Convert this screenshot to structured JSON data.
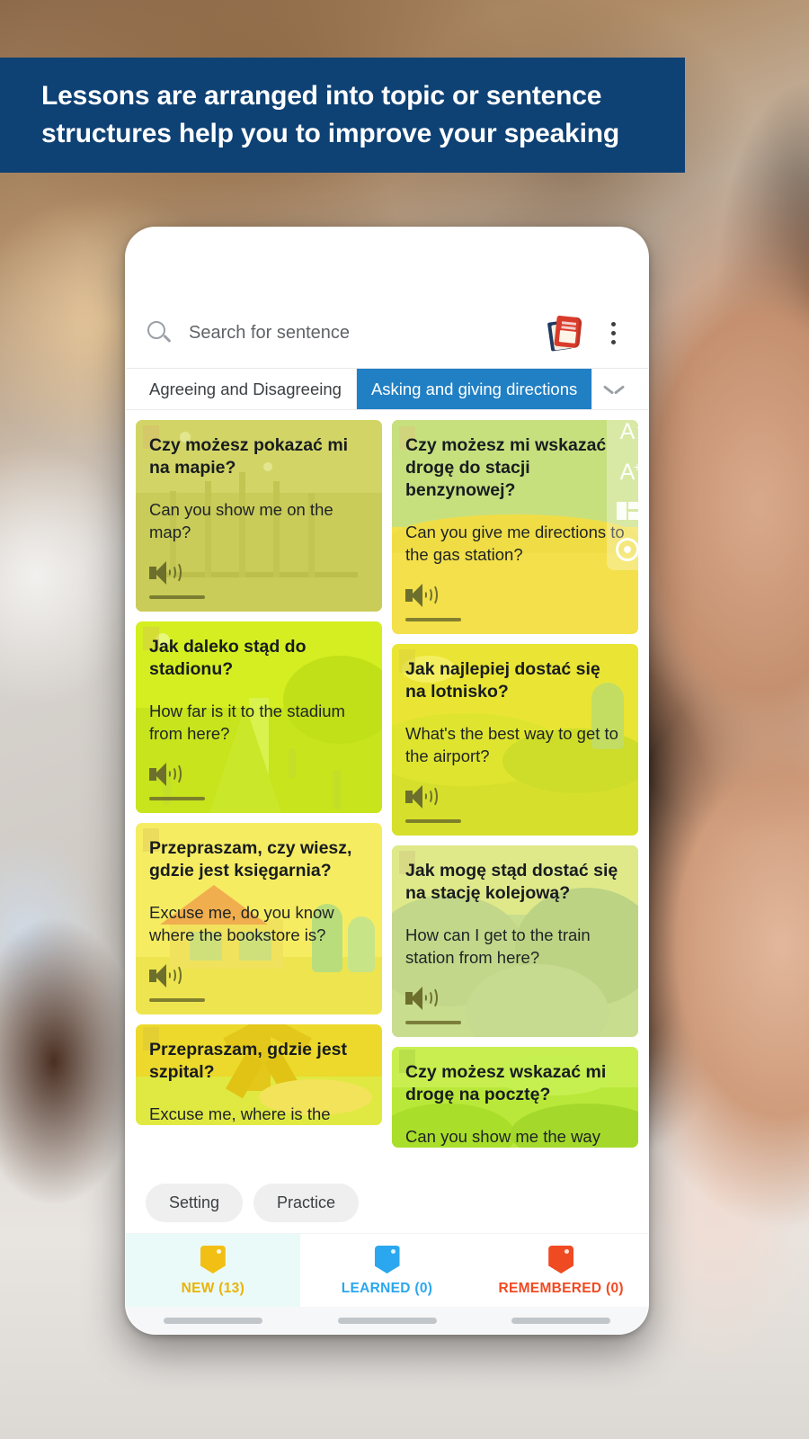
{
  "headline": {
    "line1": "Lessons are arranged into topic or sentence",
    "line2": "structures help you to improve your speaking",
    "bg_color": "#0e4174",
    "text_color": "#ffffff"
  },
  "search": {
    "placeholder": "Search for sentence",
    "icon": "search-icon",
    "book_icon": "books-icon",
    "overflow_icon": "kebab-menu-icon"
  },
  "topic_tabs": {
    "items": [
      {
        "label": "Agreeing and Disagreeing",
        "active": false
      },
      {
        "label": "Asking and giving directions",
        "active": true
      }
    ],
    "expand_icon": "chevron-down-icon",
    "active_color": "#2180c4"
  },
  "side_tools": {
    "items": [
      {
        "name": "font-decrease-icon",
        "glyph": "A",
        "sup": "-"
      },
      {
        "name": "font-increase-icon",
        "glyph": "A",
        "sup": "+"
      },
      {
        "name": "layout-grid-icon",
        "glyph": ""
      },
      {
        "name": "eye-visibility-icon",
        "glyph": ""
      }
    ]
  },
  "cards": {
    "left": [
      {
        "pl": "Czy możesz pokazać mi na mapie?",
        "en": "Can you show me on the map?",
        "theme": "bridge",
        "bg": "#d2d566",
        "audio_icon": "speaker-icon"
      },
      {
        "pl": "Jak daleko stąd do stadionu?",
        "en": "How far is it to  the stadium from here?",
        "theme": "desert-road",
        "bg": "#d4ee21",
        "audio_icon": "speaker-icon"
      },
      {
        "pl": "Przepraszam, czy wiesz, gdzie jest księgarnia?",
        "en": "Excuse me, do you know where  the bookstore is?",
        "theme": "house",
        "bg": "#f6ec62",
        "audio_icon": "speaker-icon"
      },
      {
        "pl": "Przepraszam, gdzie jest szpital?",
        "en": "Excuse me, where is  the",
        "theme": "windmill",
        "bg": "#ecd92b",
        "audio_icon": "speaker-icon"
      }
    ],
    "right": [
      {
        "pl": "Czy możesz mi wskazać drogę do stacji benzynowej?",
        "en": "Can you give me directions to  the gas station?",
        "theme": "gas-field",
        "bg": "#f3e04a",
        "audio_icon": "speaker-icon"
      },
      {
        "pl": "Jak najlepiej dostać się na lotnisko?",
        "en": "What's the best way to get to  the airport?",
        "theme": "hills",
        "bg": "#eae534",
        "audio_icon": "speaker-icon"
      },
      {
        "pl": "Jak mogę stąd dostać się na stację kolejową?",
        "en": "How can I get to  the train station from here?",
        "theme": "green-hills",
        "bg": "#c9dd8f",
        "audio_icon": "speaker-icon"
      },
      {
        "pl": "Czy możesz wskazać mi drogę na pocztę?",
        "en": "Can you show me the way",
        "theme": "green-mounds",
        "bg": "#b9e83a",
        "audio_icon": "speaker-icon"
      }
    ]
  },
  "action_chips": [
    {
      "label": "Setting"
    },
    {
      "label": "Practice"
    }
  ],
  "bottom_nav": [
    {
      "label": "NEW (13)",
      "color": "#f2c014",
      "selected": true,
      "icon": "tag-icon"
    },
    {
      "label": "LEARNED (0)",
      "color": "#2aa7ef",
      "selected": false,
      "icon": "tag-icon"
    },
    {
      "label": "REMEMBERED (0)",
      "color": "#f04a22",
      "selected": false,
      "icon": "tag-icon"
    }
  ]
}
